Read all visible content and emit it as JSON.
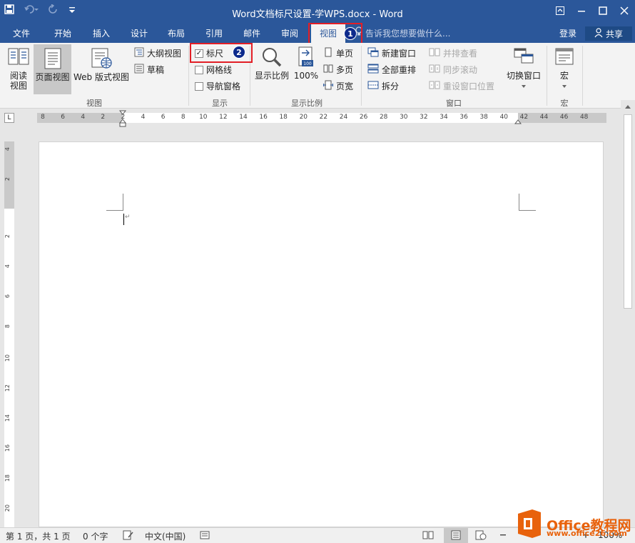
{
  "window": {
    "title": "Word文档标尺设置-学WPS.docx - Word"
  },
  "tabs": [
    "文件",
    "开始",
    "插入",
    "设计",
    "布局",
    "引用",
    "邮件",
    "审阅",
    "视图"
  ],
  "tell_me": "告诉我您想要做什么...",
  "account": {
    "login": "登录",
    "share": "共享"
  },
  "ribbon": {
    "views": {
      "read_mode": "阅读\n视图",
      "read_mode_l1": "阅读",
      "read_mode_l2": "视图",
      "print_layout": "页面视图",
      "web_layout": "Web 版式视图",
      "outline": "大纲视图",
      "draft": "草稿",
      "label": "视图"
    },
    "show": {
      "ruler": "标尺",
      "gridlines": "网格线",
      "nav_pane": "导航窗格",
      "label": "显示",
      "ruler_checked": true
    },
    "zoom": {
      "zoom": "显示比例",
      "hundred": "100%",
      "one_page": "单页",
      "multi_page": "多页",
      "page_width": "页宽",
      "label": "显示比例",
      "badge100": "100"
    },
    "window": {
      "new_window": "新建窗口",
      "arrange_all": "全部重排",
      "split": "拆分",
      "side_by_side": "并排查看",
      "sync_scroll": "同步滚动",
      "reset_pos": "重设窗口位置",
      "switch": "切换窗口",
      "label": "窗口"
    },
    "macros": {
      "macros": "宏",
      "label": "宏"
    }
  },
  "markers": {
    "one": "1",
    "two": "2"
  },
  "ruler_labels": [
    "8",
    "6",
    "4",
    "2",
    "2",
    "4",
    "6",
    "8",
    "10",
    "12",
    "14",
    "16",
    "18",
    "20",
    "22",
    "24",
    "26",
    "28",
    "30",
    "32",
    "34",
    "36",
    "38",
    "40",
    "42",
    "44",
    "46",
    "48"
  ],
  "vruler_labels": [
    "4",
    "2",
    "2",
    "4",
    "6",
    "8",
    "10",
    "12",
    "14",
    "16",
    "18",
    "20"
  ],
  "corner_tab": "L",
  "status": {
    "page": "第 1 页，共 1 页",
    "words": "0 个字",
    "lang": "中文(中国)",
    "zoom": "100%"
  },
  "logo": {
    "brand": "Office教程网",
    "url": "www.office26.com"
  },
  "colors": {
    "brand_blue": "#2b579a",
    "highlight_red": "#e21e26",
    "badge_navy": "#0d2a8c",
    "logo_orange": "#e8620c"
  }
}
